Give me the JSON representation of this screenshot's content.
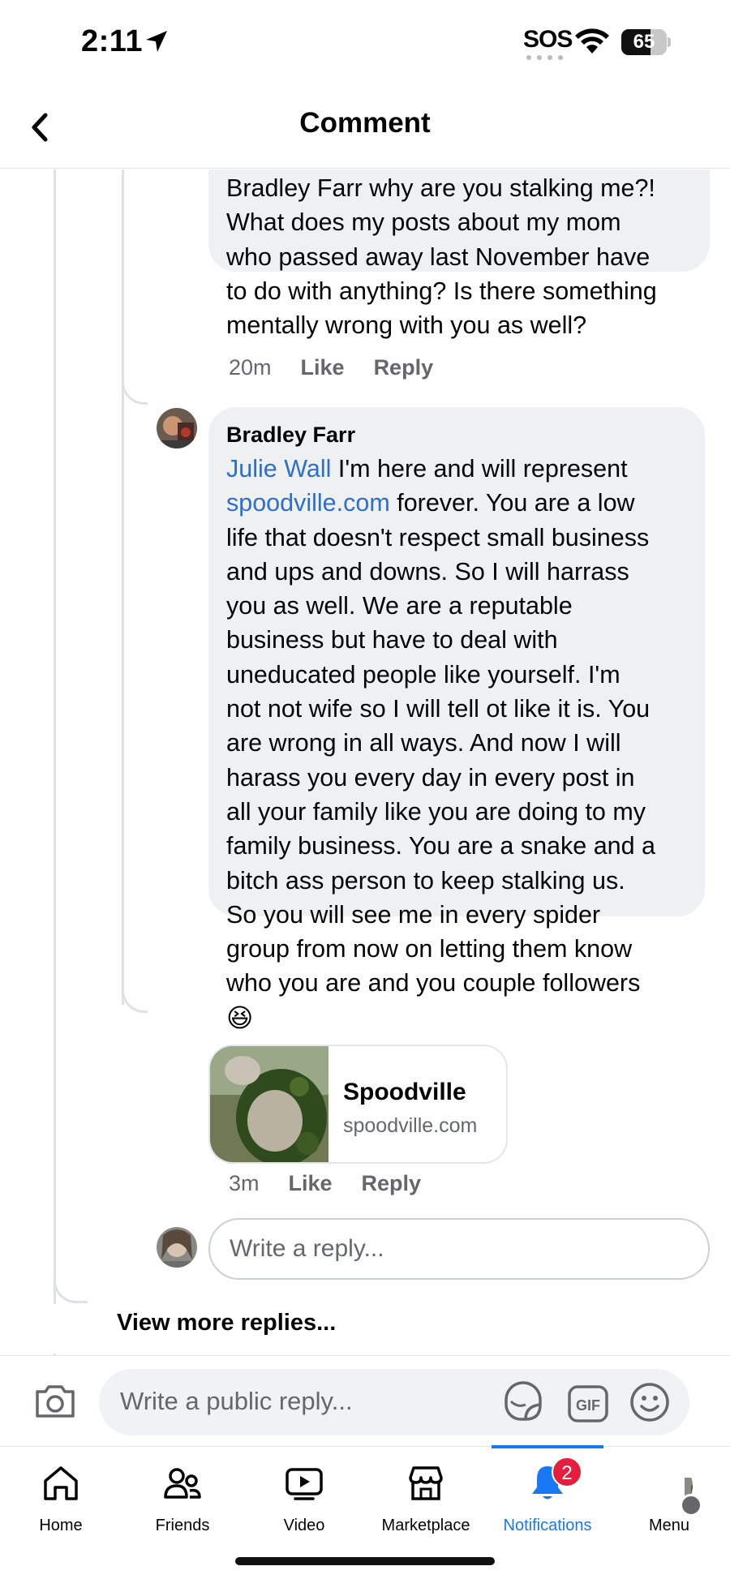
{
  "status_bar": {
    "time": "2:11",
    "sos": "SOS",
    "battery": "65",
    "battery_level": 0.65
  },
  "header": {
    "title": "Comment"
  },
  "comments": [
    {
      "text_lines": [
        "Bradley Farr why are you stalking me?!",
        "What does my posts about my mom",
        "who passed away last November have",
        "to do with anything? Is there something",
        "mentally wrong with you as well?"
      ],
      "time": "20m",
      "like": "Like",
      "reply": "Reply"
    },
    {
      "author": "Bradley Farr",
      "mention": "Julie Wall",
      "line1_rest": " I'm here and will represent",
      "link_text": "spoodville.com",
      "line2_rest": " forever. You are a low",
      "text_lines": [
        "life that doesn't respect small business",
        "and ups and downs. So I will harrass",
        "you as well. We are a reputable",
        "business but have to deal with",
        "uneducated people like yourself. I'm",
        "not not wife so I will tell ot like it is. You",
        "are wrong in all ways. And now I will",
        "harass you every day in every post in",
        "all your family like you are doing to my",
        "family business. You are a snake and a",
        "bitch ass person to keep stalking us.",
        "So you will see me in every spider",
        "group from now on letting them know",
        "who you are and you couple followers"
      ],
      "emoji": "😆",
      "link_preview": {
        "title": "Spoodville",
        "domain": "spoodville.com"
      },
      "time": "3m",
      "like": "Like",
      "reply": "Reply"
    }
  ],
  "reply_input": {
    "placeholder": "Write a reply..."
  },
  "view_more": "View more replies...",
  "composer": {
    "placeholder": "Write a public reply..."
  },
  "nav": {
    "items": [
      {
        "label": "Home",
        "icon": "home-icon"
      },
      {
        "label": "Friends",
        "icon": "friends-icon"
      },
      {
        "label": "Video",
        "icon": "video-icon"
      },
      {
        "label": "Marketplace",
        "icon": "marketplace-icon"
      },
      {
        "label": "Notifications",
        "icon": "bell-icon",
        "badge": "2",
        "active": true
      },
      {
        "label": "Menu",
        "icon": "menu-avatar"
      }
    ]
  },
  "colors": {
    "accent": "#1877f2",
    "link": "#2d6fcb",
    "bubble": "#eff0f2",
    "badge": "#e41e3f"
  }
}
